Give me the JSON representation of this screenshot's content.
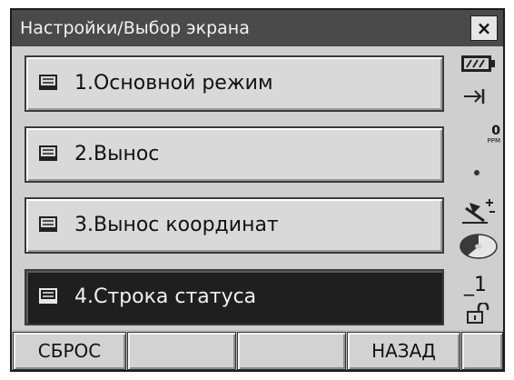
{
  "window": {
    "title": "Настройки/Выбор экрана",
    "close_label": "×"
  },
  "menu": {
    "items": [
      {
        "label": "1.Основной режим",
        "selected": false
      },
      {
        "label": "2.Вынос",
        "selected": false
      },
      {
        "label": "3.Вынос координат",
        "selected": false
      },
      {
        "label": "4.Строка статуса",
        "selected": true
      }
    ]
  },
  "status": {
    "ppm_label": "PPM",
    "ppm_value": "0",
    "prism_constant": "_1",
    "icons": [
      "battery-icon",
      "target-mode-icon",
      "ppm-indicator",
      "dot-indicator",
      "tilt-compensation-icon",
      "disk-icon",
      "prism-constant-indicator",
      "lock-icon"
    ]
  },
  "softkeys": [
    {
      "label": "СБРОС"
    },
    {
      "label": ""
    },
    {
      "label": ""
    },
    {
      "label": "НАЗАД"
    },
    {
      "label": ""
    }
  ]
}
